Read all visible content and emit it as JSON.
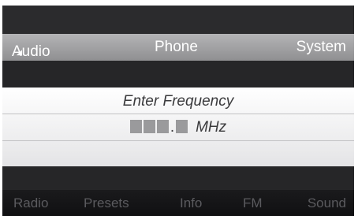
{
  "menu": {
    "audio": "Audio",
    "audio_arrow": "◢",
    "phone": "Phone",
    "system": "System"
  },
  "dialog": {
    "title": "Enter Frequency",
    "separator": ".",
    "unit": "MHz"
  },
  "bottom_menu": {
    "radio": "Radio",
    "presets": "Presets",
    "info": "Info",
    "fm": "FM",
    "sound": "Sound"
  },
  "colors": {
    "menu_bar": "#a3a3a5",
    "dialog_background": "#f4f4f6",
    "bottom_text": "#5b5b5f"
  }
}
